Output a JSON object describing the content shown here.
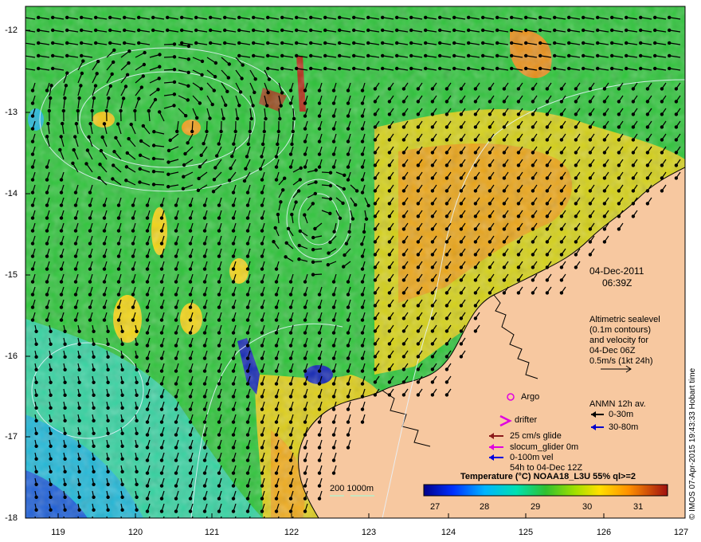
{
  "map": {
    "lat_ticks": [
      "-12",
      "-13",
      "-14",
      "-15",
      "-16",
      "-17",
      "-18"
    ],
    "lon_ticks": [
      "119",
      "120",
      "121",
      "122",
      "123",
      "124",
      "125",
      "126",
      "127"
    ],
    "lat_range": [
      -18,
      -11.8
    ],
    "lon_range": [
      118.6,
      127
    ]
  },
  "timestamp": {
    "date": "04-Dec-2011",
    "time": "06:39Z"
  },
  "altimetry_note": {
    "lines": [
      "Altimetric sealevel",
      "(0.1m contours)",
      "and velocity for",
      "04-Dec 06Z",
      "0.5m/s (1kt 24h)"
    ]
  },
  "anmn": {
    "title": "ANMN 12h av.",
    "items": [
      {
        "label": "0-30m",
        "color": "#000000"
      },
      {
        "label": "30-80m",
        "color": "#0000cc"
      }
    ]
  },
  "legend": {
    "argo": "Argo",
    "drifter": "drifter",
    "glide": "25 cm/s glide",
    "slocum": "slocum_glider 0m",
    "vel": "0-100m vel",
    "vel_time": "54h to 04-Dec 12Z",
    "argo_color": "#e000e0",
    "drifter_color": "#e000e0",
    "glide_color": "#8b1a1a",
    "slocum_color": "#e000e0",
    "vel_color": "#0000dd"
  },
  "bathy": {
    "label": "200  1000m"
  },
  "colorbar": {
    "title": "Temperature (°C) NOAA18_L3U 55% ql>=2",
    "ticks": [
      "27",
      "28",
      "29",
      "30",
      "31"
    ],
    "range": [
      26.6,
      31.8
    ]
  },
  "credit": "© IMOS 07-Apr-2015 19:43:33 Hobart time",
  "colors": {
    "land": "#f7c8a0",
    "background": "#ffffff"
  }
}
